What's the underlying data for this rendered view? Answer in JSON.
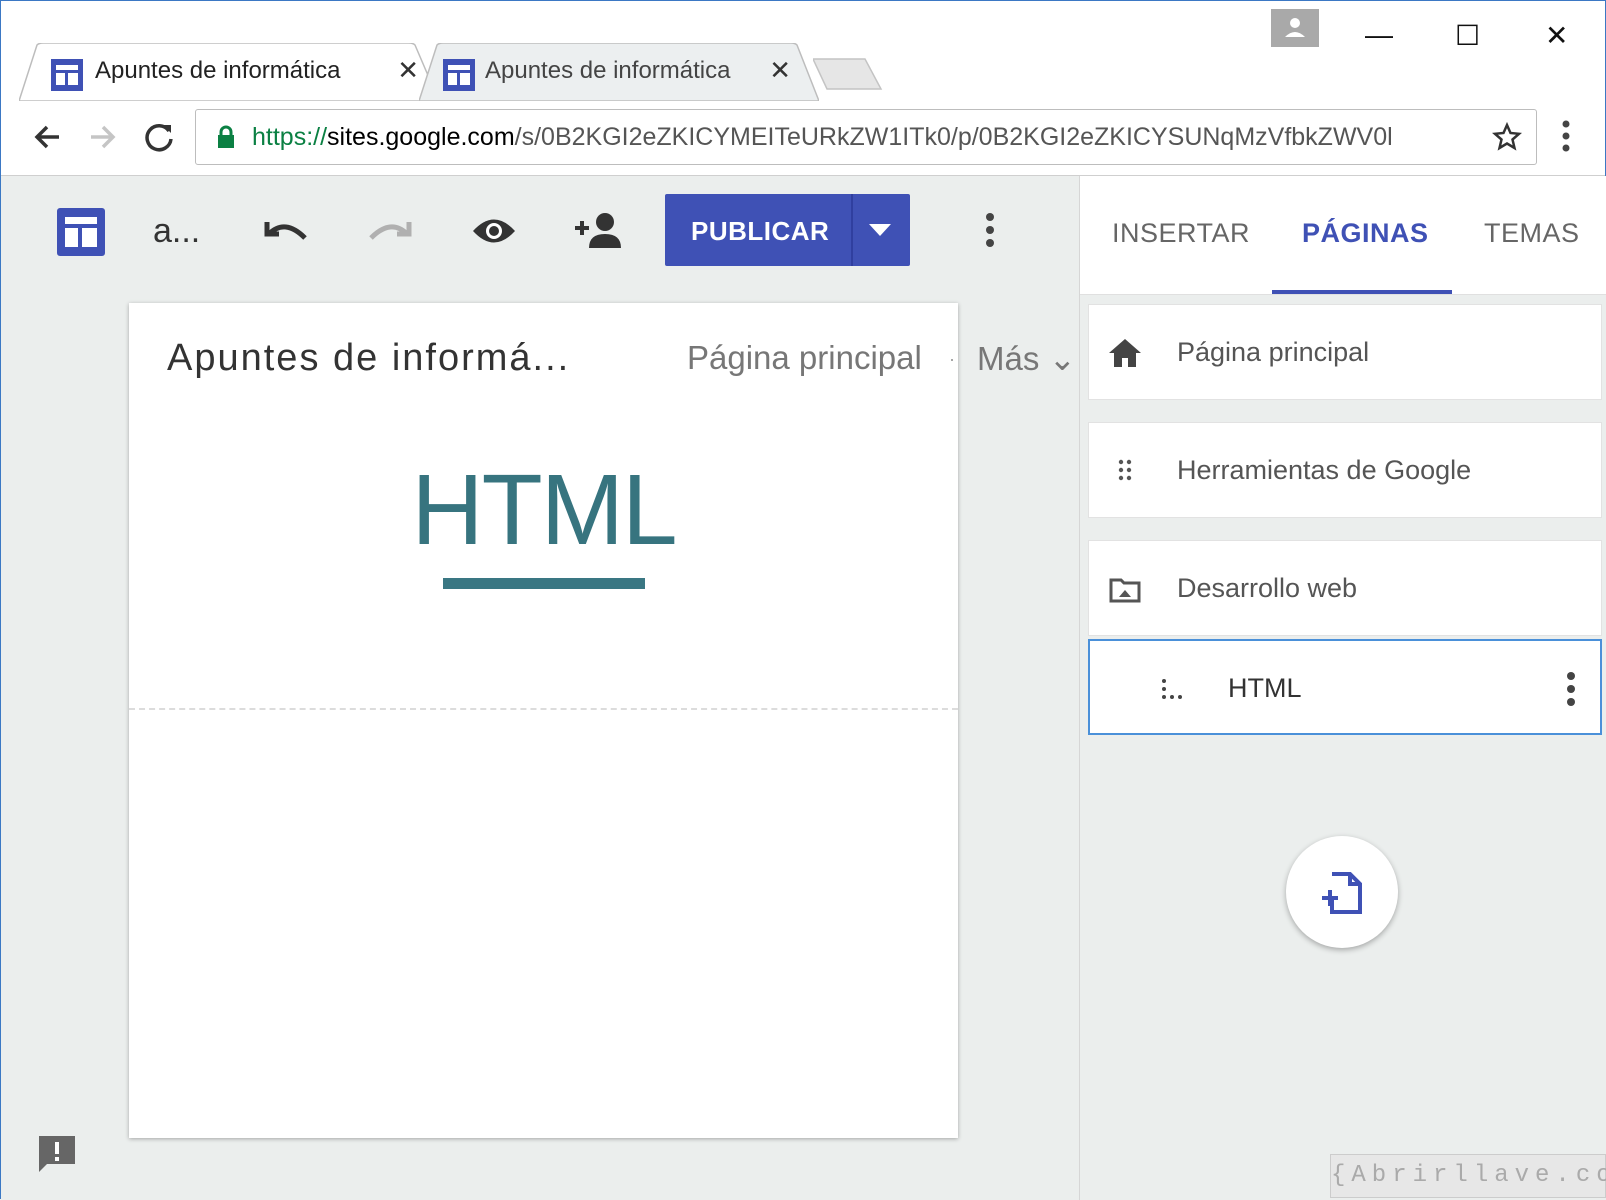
{
  "browser": {
    "tabs": [
      {
        "title": "Apuntes de informática",
        "close": "✕"
      },
      {
        "title": "Apuntes de informática",
        "close": "✕"
      }
    ],
    "window_controls": {
      "minimize": "—",
      "maximize": "☐",
      "close": "✕"
    },
    "address": {
      "scheme": "https://",
      "host": "sites.google.com",
      "path": "/s/0B2KGI2eZKICYMEITeURkZW1ITk0/p/0B2KGI2eZKICYSUNqMzVfbkZWV0l"
    }
  },
  "editor_toolbar": {
    "site_abbrev": "a...",
    "publish_label": "PUBLICAR"
  },
  "page": {
    "site_title": "Apuntes de informá...",
    "nav_home": "Página principal",
    "nav_sep": "·",
    "nav_more": "Más ⌄",
    "hero_title": "HTML"
  },
  "side_panel": {
    "tabs": [
      {
        "label": "INSERTAR"
      },
      {
        "label": "PÁGINAS"
      },
      {
        "label": "TEMAS"
      }
    ],
    "active_tab": "PÁGINAS",
    "pages": [
      {
        "label": "Página principal",
        "icon": "home-icon"
      },
      {
        "label": "Herramientas de Google",
        "icon": "drag-handle-icon"
      },
      {
        "label": "Desarrollo web",
        "icon": "folder-icon"
      },
      {
        "label": "HTML",
        "icon": "subpage-handle-icon",
        "selected": true
      }
    ]
  },
  "watermark": "{Abrirllave.com",
  "colors": {
    "accent": "#3f51b5",
    "hero": "#37747f",
    "selected_border": "#4a90d9"
  }
}
